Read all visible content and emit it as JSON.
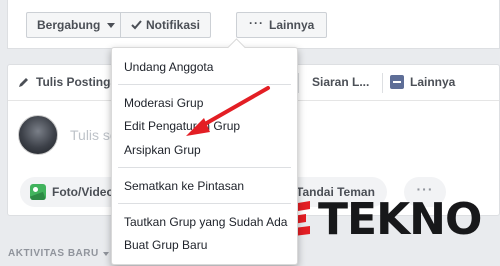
{
  "header": {
    "join_label": "Bergabung",
    "notif_label": "Notifikasi",
    "more_label": "Lainnya"
  },
  "composer": {
    "tabs": {
      "write": "Tulis Postinga",
      "live": "Siaran L...",
      "more": "Lainnya"
    },
    "placeholder": "Tulis se",
    "actions": {
      "photo": "Foto/Video",
      "tag": "Tandai Teman"
    }
  },
  "activity_label": "AKTIVITAS BARU",
  "menu": {
    "items": [
      "Undang Anggota",
      "Moderasi Grup",
      "Edit Pengaturan Grup",
      "Arsipkan Grup",
      "Sematkan ke Pintasan",
      "Tautkan Grup yang Sudah Ada",
      "Buat Grup Baru"
    ]
  },
  "watermark": {
    "text": "TEKNO",
    "brand_color": "#e31e24"
  },
  "annotation": {
    "arrow_color": "#e31e24"
  },
  "icons": [
    "check-icon",
    "pencil-icon",
    "live-video-icon",
    "more-tab-icon",
    "photo-icon",
    "ellipsis-icon"
  ]
}
